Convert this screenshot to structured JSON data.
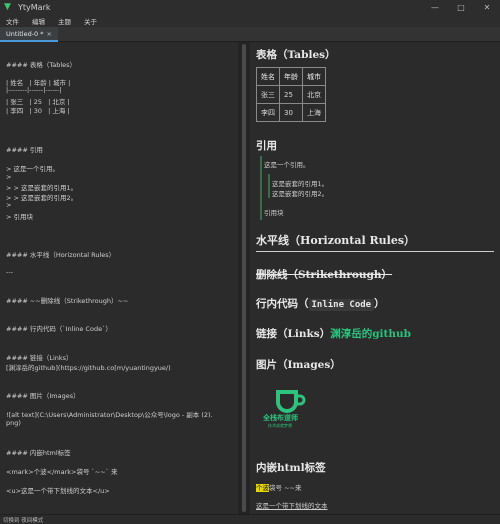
{
  "window": {
    "app_title": "YtyMark",
    "controls": [
      "—",
      "□",
      "✕"
    ]
  },
  "menu": [
    "文件",
    "编辑",
    "主题",
    "关于"
  ],
  "tab": {
    "label": "Untitled-0 *",
    "close": "×"
  },
  "editor_lines": [
    "#### 表格（Tables）",
    "| 姓名   | 年龄 | 城市 |",
    "|--------|------|------|",
    "| 张三   | 25   | 北京 |",
    "| 李四   | 30   | 上海 |",
    "#### 引用",
    "> 这是一个引用。",
    ">",
    "> > 这是嵌套的引用1。",
    "> > 这是嵌套的引用2。",
    ">",
    "> 引用块",
    "#### 水平线（Horizontal Rules）",
    "---",
    "#### ~~删除线（Strikethrough）~~",
    "#### 行内代码（`Inline Code`）",
    "#### 链接（Links）",
    "[渊淳岳的github](https://github.co[m/yuantingyue/)",
    "#### 图片（Images）",
    "![alt text](C:\\Users\\Administrator\\Desktop\\公众号\\logo - 副本 (2).",
    "png)",
    "#### 内嵌html标签",
    "<mark>个波</mark>袋号 `~~` 来",
    "<u>这是一个带下划线的文本</u>"
  ],
  "preview": {
    "tables_heading": "表格（Tables）",
    "table": {
      "headers": [
        "姓名",
        "年龄",
        "城市"
      ],
      "rows": [
        [
          "张三",
          "25",
          "北京"
        ],
        [
          "李四",
          "30",
          "上海"
        ]
      ]
    },
    "quote_heading": "引用",
    "quote_line1": "这是一个引用。",
    "quote_nested1": "这是嵌套的引用1。",
    "quote_nested2": "这是嵌套的引用2。",
    "quote_last": "引用块",
    "hr_heading": "水平线（Horizontal Rules）",
    "strike_heading": "删除线（Strikethrough）",
    "code_heading_prefix": "行内代码（",
    "code_heading_code": "Inline Code",
    "code_heading_suffix": "）",
    "links_heading_prefix": "链接（Links）",
    "links_heading_link": "渊淳岳的github",
    "images_heading": "图片（Images）",
    "logo_text": "全栈布道师",
    "logo_subtext": "技术成就梦想",
    "html_heading": "内嵌html标签",
    "mark_text": "个波",
    "mark_after": "袋号 ~~来",
    "underline_text": "这是一个带下划线的文本"
  },
  "status": "切换到 夜间模式",
  "colors": {
    "accent": "#2ec27e",
    "mark": "#e6d800",
    "tab_underline": "#4a9ad9"
  }
}
